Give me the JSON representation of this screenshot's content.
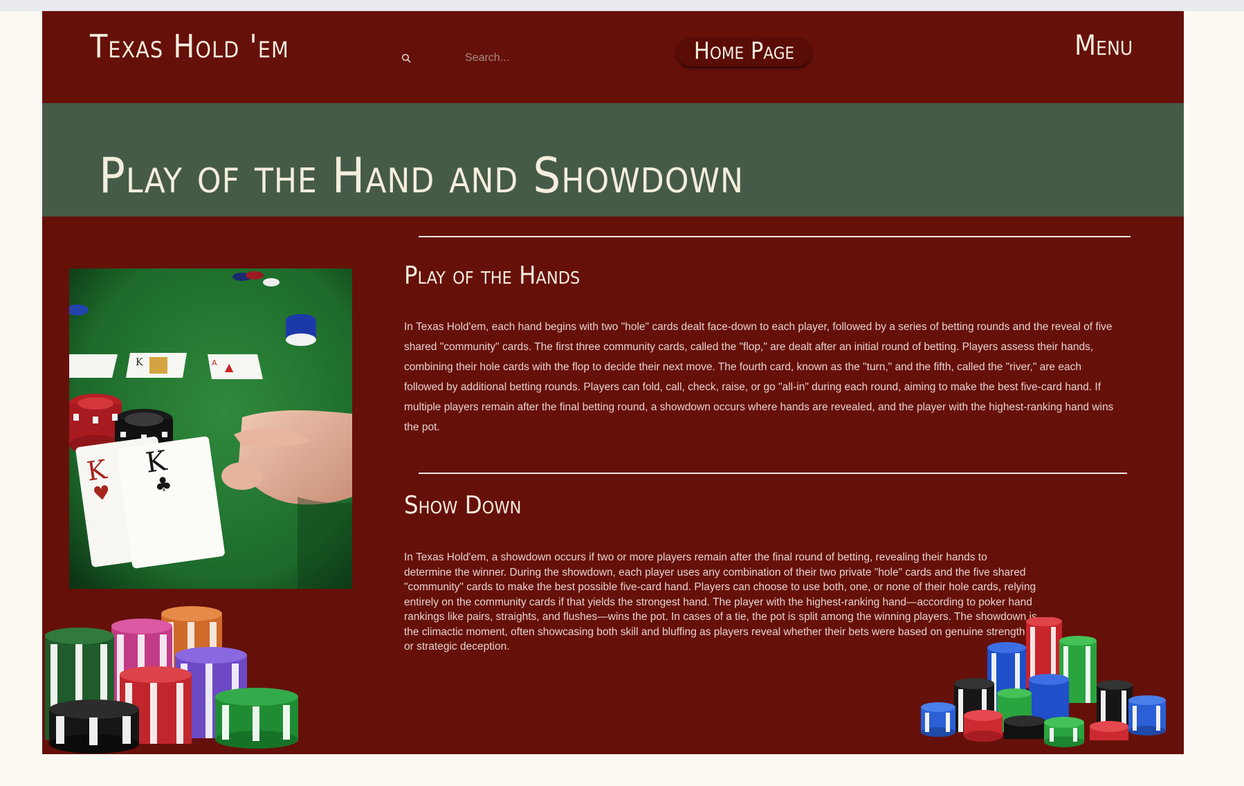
{
  "header": {
    "brand": "Texas Hold 'em",
    "search_placeholder": "Search...",
    "home_button": "Home Page",
    "menu": "Menu"
  },
  "hero": {
    "title": "Play of the Hand and Showdown"
  },
  "sections": [
    {
      "title": "Play of the Hands",
      "body": "In Texas Hold'em, each hand begins with two \"hole\" cards dealt face-down to each player, followed by a series of betting rounds and the reveal of five shared \"community\" cards. The first three community cards, called the \"flop,\" are dealt after an initial round of betting. Players assess their hands, combining their hole cards with the flop to decide their next move. The fourth card, known as the \"turn,\" and the fifth, called the \"river,\" are each followed by additional betting rounds. Players can fold, call, check, raise, or go \"all-in\" during each round, aiming to make the best five-card hand. If multiple players remain after the final betting round, a showdown occurs where hands are revealed, and the player with the highest-ranking hand wins the pot."
    },
    {
      "title": "Show Down",
      "body": "In Texas Hold'em, a showdown occurs if two or more players remain after the final round of betting, revealing their hands to determine the winner. During the showdown, each player uses any combination of their two private \"hole\" cards and the five shared \"community\" cards to make the best possible five-card hand. Players can choose to use both, one, or none of their hole cards, relying entirely on the community cards if that yields the strongest hand. The player with the highest-ranking hand—according to poker hand rankings like pairs, straights, and flushes—wins the pot. In cases of a tie, the pot is split among the winning players. The showdown is the climactic moment, often showcasing both skill and bluffing as players reveal whether their bets were based on genuine strength or strategic deception."
    }
  ],
  "colors": {
    "background": "#66100a",
    "hero_band": "#465b47",
    "text": "#f4eddd",
    "felt": "#1e6b2c"
  },
  "icons": [
    "search-icon"
  ],
  "images": [
    "poker-hand-photo",
    "chip-stacks-left",
    "chip-stacks-right"
  ]
}
